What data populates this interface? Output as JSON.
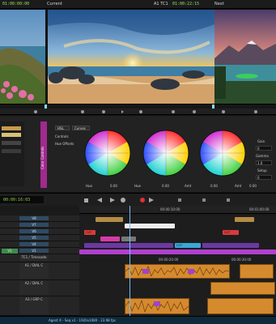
{
  "topbar": {
    "left_timecode": "01:00:00:00",
    "left_source": "Current",
    "right_timecode": "01:00:22:15",
    "right_label": "A1  TC1",
    "next_label": "Next"
  },
  "color_panel": {
    "side_label": "Color Controls",
    "tabs": [
      "HSL",
      "Curves"
    ],
    "options": [
      "Controls",
      "Hue Offsets"
    ],
    "wheels": [
      {
        "name": "shadows",
        "hue_label": "Hue",
        "hue_value": "0.00",
        "amount_label": "Amt",
        "amount_value": "0.00"
      },
      {
        "name": "midtones",
        "hue_label": "Hue",
        "hue_value": "0.00",
        "amount_label": "Amt",
        "amount_value": "0.00"
      },
      {
        "name": "highlights",
        "hue_label": "Hue",
        "hue_value": "0.00",
        "amount_label": "Amt",
        "amount_value": "0.00"
      }
    ],
    "gain_label": "Gain",
    "gain_value": "0",
    "gamma_label": "Gamma",
    "gamma_value": "1.0",
    "setup_label": "Setup",
    "setup_value": "0"
  },
  "transport": {
    "timecode": "00:00:16:03"
  },
  "timeline": {
    "ruler_marks": [
      "00:00:10:00",
      "00:01:00:00"
    ],
    "ruler_marks_lower": [
      "00:00:20:00",
      "00:00:30:00"
    ],
    "tracks": [
      "V8",
      "V7",
      "V6",
      "V5",
      "V4",
      "V3",
      "V2",
      "V1",
      "TC1 / Timecode",
      "A1 / DIAL C",
      "A2 / DIAL C",
      "A3 / GRP C",
      "A4 / GRP C"
    ],
    "v1_label": "V1",
    "clip_labels": [
      "CUT",
      "TRK",
      "CUT",
      "CUT",
      "CUT"
    ]
  },
  "status": {
    "text": "Agent X - Seq v1 - 1920x1080 - 23.98 fps"
  }
}
